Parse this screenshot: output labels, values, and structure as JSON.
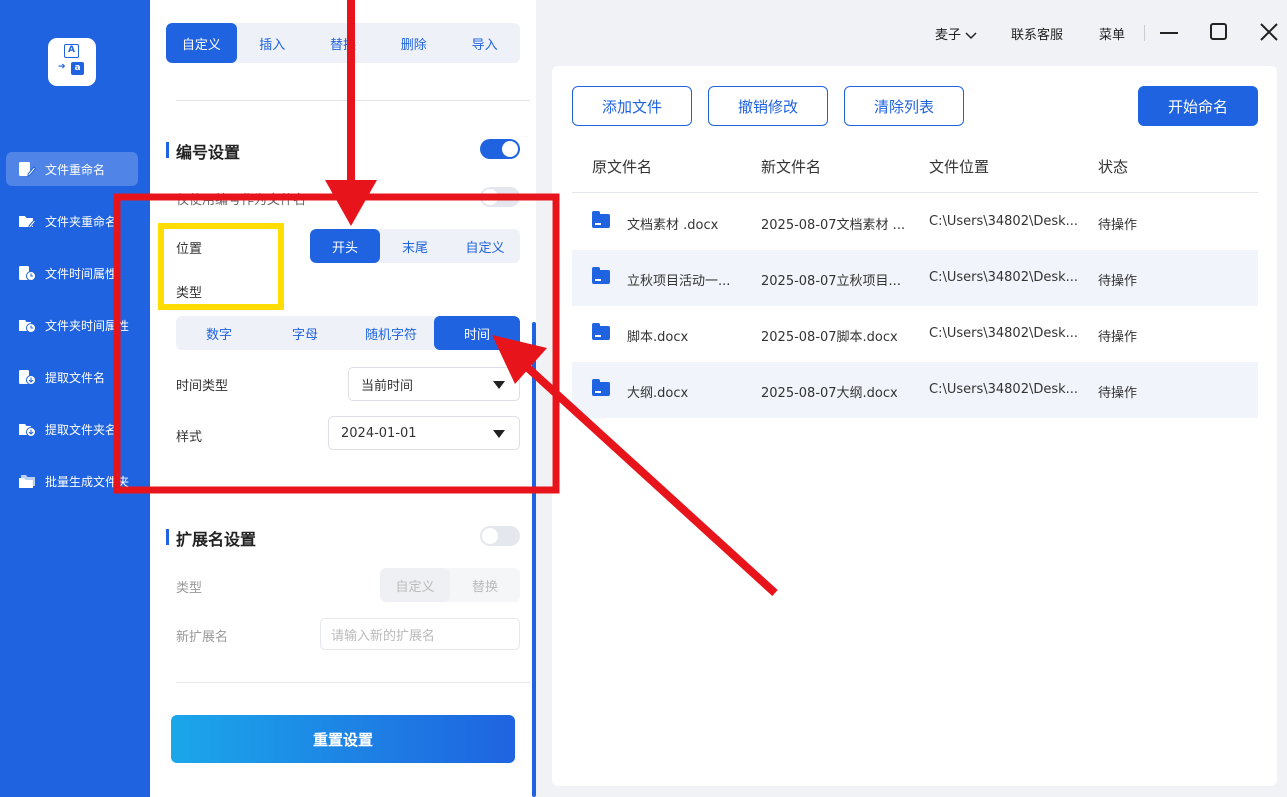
{
  "sidebar": {
    "items": [
      {
        "label": "文件重命名",
        "active": true
      },
      {
        "label": "文件夹重命名",
        "active": false
      },
      {
        "label": "文件时间属性",
        "active": false
      },
      {
        "label": "文件夹时间属性",
        "active": false
      },
      {
        "label": "提取文件名",
        "active": false
      },
      {
        "label": "提取文件夹名",
        "active": false
      },
      {
        "label": "批量生成文件夹",
        "active": false
      }
    ]
  },
  "mode_tabs": [
    "自定义",
    "插入",
    "替换",
    "删除",
    "导入"
  ],
  "numbering": {
    "title": "编号设置",
    "enabled": true,
    "hidden_option": "仅使用编号作为文件名",
    "position_label": "位置",
    "position_options": [
      "开头",
      "末尾",
      "自定义"
    ],
    "type_label": "类型",
    "type_options": [
      "数字",
      "字母",
      "随机字符",
      "时间"
    ],
    "time_type_label": "时间类型",
    "time_type_value": "当前时间",
    "style_label": "样式",
    "style_value": "2024-01-01"
  },
  "extension": {
    "title": "扩展名设置",
    "enabled": false,
    "type_label": "类型",
    "type_options": [
      "自定义",
      "替换"
    ],
    "new_ext_label": "新扩展名",
    "new_ext_placeholder": "请输入新的扩展名"
  },
  "reset_label": "重置设置",
  "topbar": {
    "user": "麦子",
    "support": "联系客服",
    "menu": "菜单"
  },
  "toolbar": {
    "add": "添加文件",
    "undo": "撤销修改",
    "clear": "清除列表",
    "start": "开始命名"
  },
  "table": {
    "headers": [
      "原文件名",
      "新文件名",
      "文件位置",
      "状态"
    ],
    "rows": [
      {
        "orig": "文档素材 .docx",
        "new": "2025-08-07文档素材 ...",
        "loc": "C:\\Users\\34802\\Desk...",
        "status": "待操作"
      },
      {
        "orig": "立秋项目活动一...",
        "new": "2025-08-07立秋项目...",
        "loc": "C:\\Users\\34802\\Desk...",
        "status": "待操作"
      },
      {
        "orig": "脚本.docx",
        "new": "2025-08-07脚本.docx",
        "loc": "C:\\Users\\34802\\Desk...",
        "status": "待操作"
      },
      {
        "orig": "大纲.docx",
        "new": "2025-08-07大纲.docx",
        "loc": "C:\\Users\\34802\\Desk...",
        "status": "待操作"
      }
    ]
  },
  "colors": {
    "accent": "#1f63e0",
    "annotation_red": "#e8141c",
    "annotation_yellow": "#ffdd00"
  }
}
